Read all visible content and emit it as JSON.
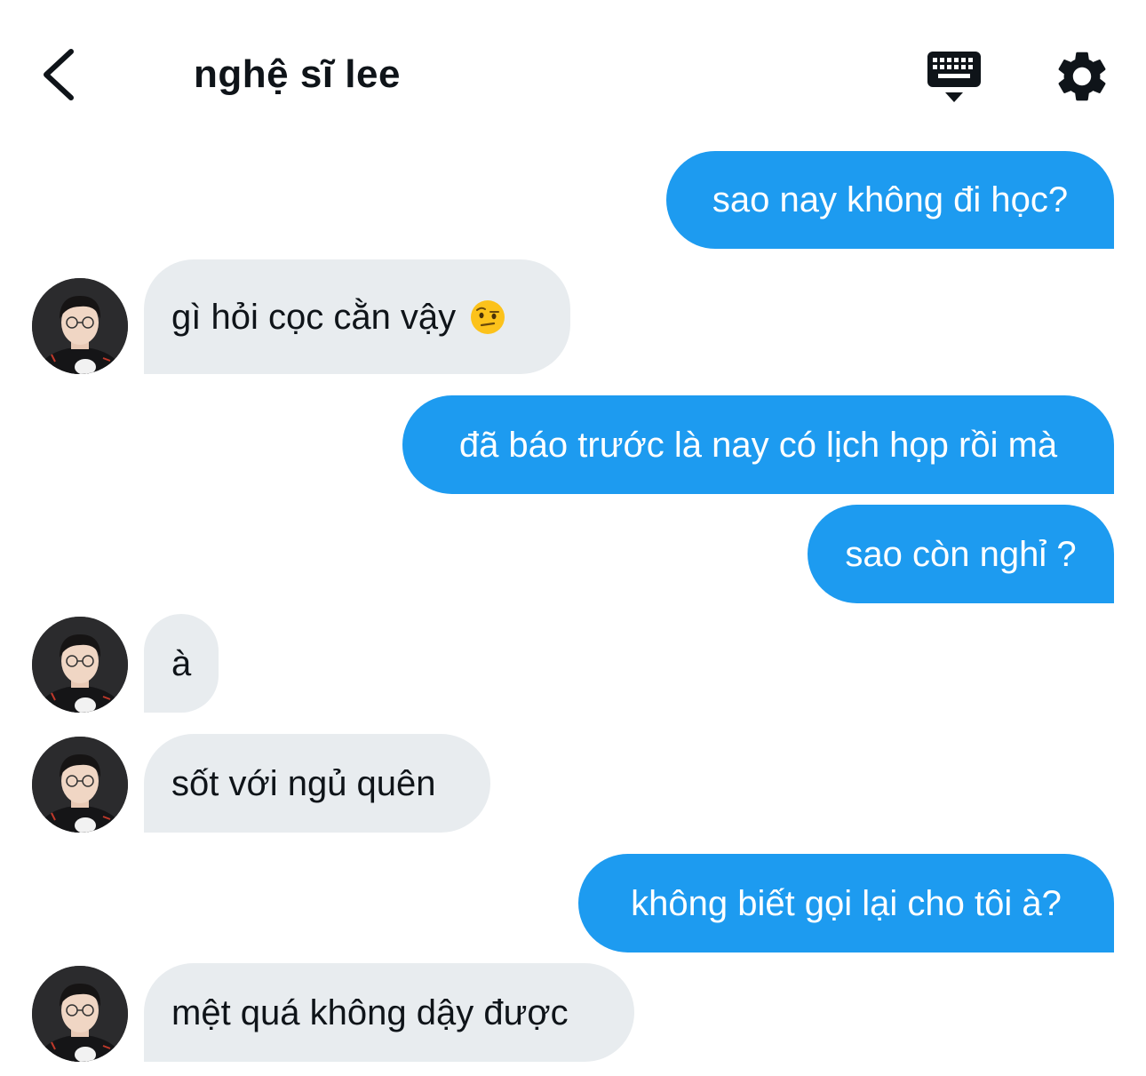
{
  "header": {
    "title": "nghệ sĩ lee",
    "icons": {
      "back": "chevron-left-icon",
      "keyboard": "keyboard-icon",
      "settings": "gear-icon"
    }
  },
  "colors": {
    "outgoing_bubble": "#1d9bf0",
    "incoming_bubble": "#e8ecef",
    "text_dark": "#0f1419"
  },
  "messages": [
    {
      "side": "out",
      "text": "sao nay không đi học?"
    },
    {
      "side": "in",
      "text": "gì hỏi cọc cằn vậy",
      "emoji": "face-with-raised-eyebrow"
    },
    {
      "side": "out",
      "text": "đã báo trước là nay có lịch họp rồi mà"
    },
    {
      "side": "out",
      "text": "sao còn nghỉ ?"
    },
    {
      "side": "in",
      "text": "à"
    },
    {
      "side": "in",
      "text": "sốt với ngủ quên"
    },
    {
      "side": "out",
      "text": "không biết gọi lại cho tôi à?"
    },
    {
      "side": "in",
      "text": "mệt quá không dậy được"
    }
  ]
}
